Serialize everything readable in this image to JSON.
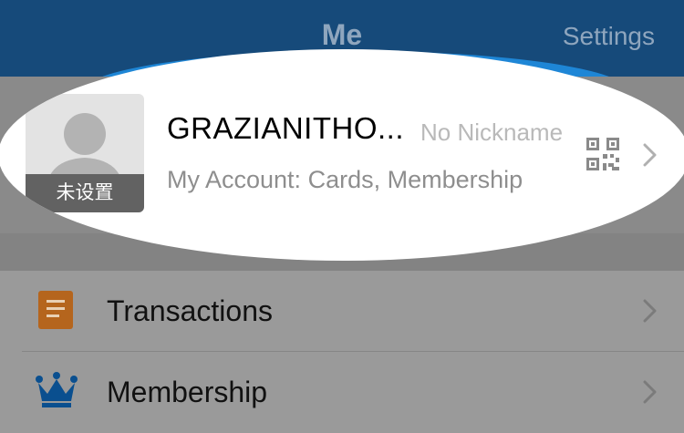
{
  "header": {
    "title": "Me",
    "settings_label": "Settings"
  },
  "profile": {
    "avatar_label": "未设置",
    "username": "GRAZIANITHO...",
    "nickname": "No Nickname",
    "account_text": "My Account: Cards, Membership"
  },
  "menu": {
    "items": [
      {
        "label": "Transactions",
        "icon": "receipt-icon"
      },
      {
        "label": "Membership",
        "icon": "crown-icon"
      }
    ]
  },
  "colors": {
    "header_bg": "#164a7a",
    "header_glow": "#1e86d6",
    "dim_overlay": "#838383",
    "transactions_icon": "#b5651d",
    "membership_icon": "#0a4f8f"
  }
}
